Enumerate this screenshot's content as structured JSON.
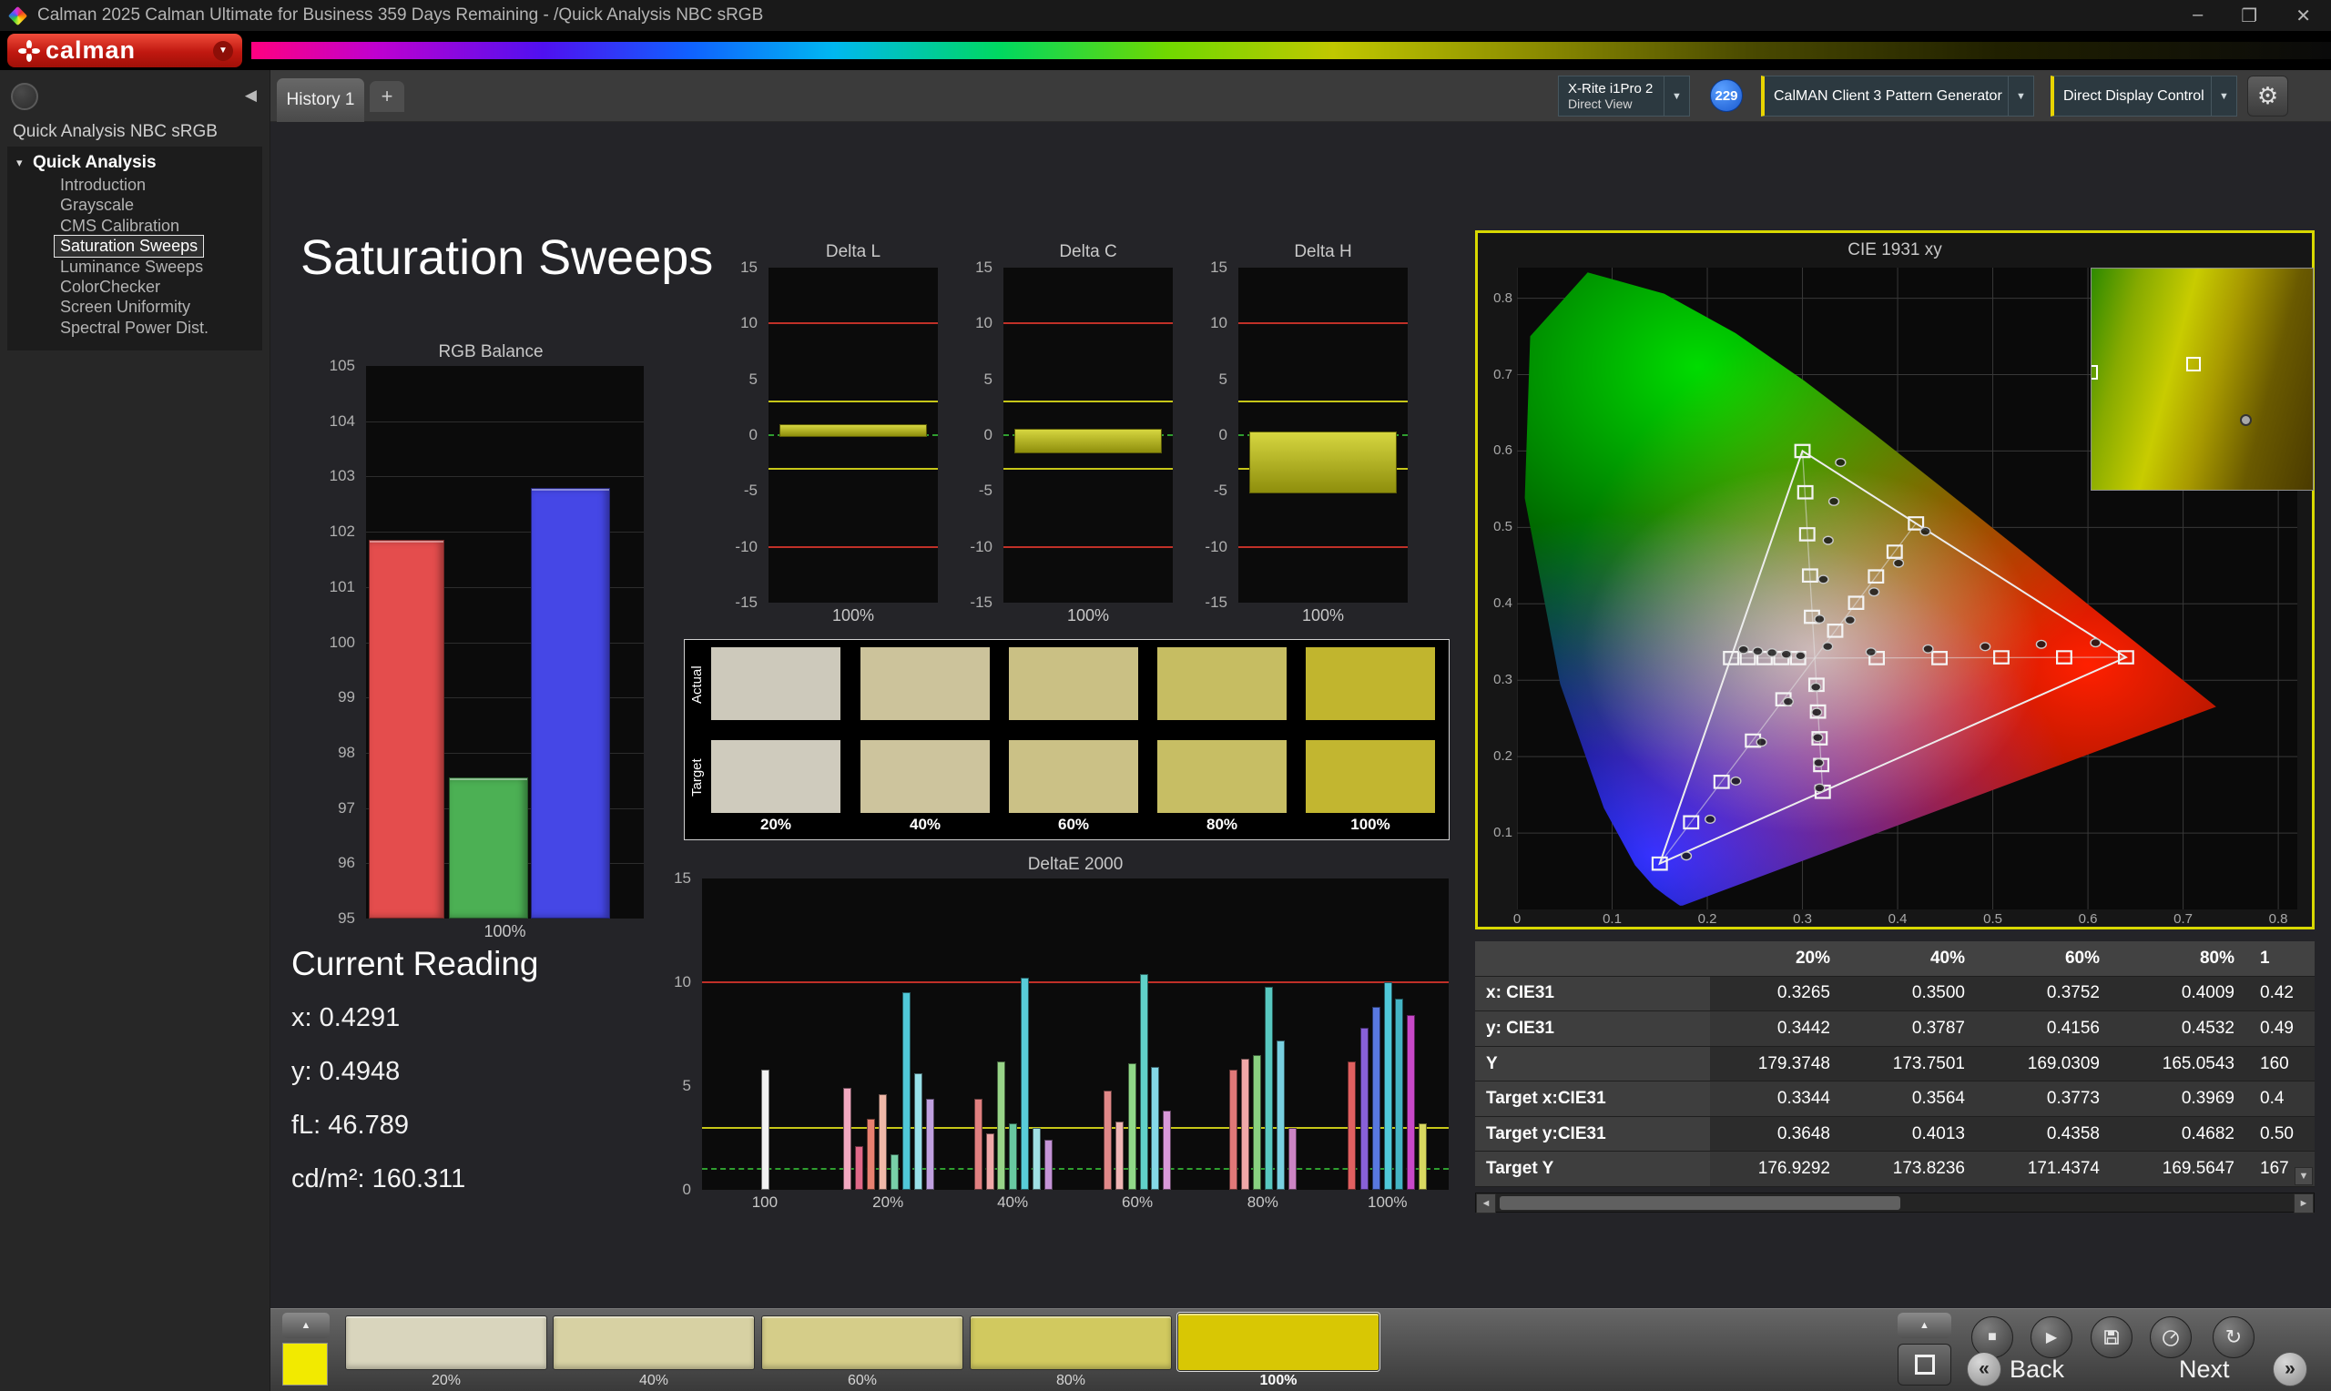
{
  "title_bar": {
    "title": "Calman 2025 Calman Ultimate for Business 359 Days Remaining  - /Quick Analysis NBC sRGB",
    "minimize": "–",
    "maximize": "❐",
    "close": "✕"
  },
  "brand": {
    "logo_text": "calman",
    "caret": "▼"
  },
  "tabs": {
    "history": "History 1",
    "add": "+"
  },
  "toolbar": {
    "meter_line1": "X-Rite i1Pro 2",
    "meter_line2": "Direct View",
    "meter_caret": "▼",
    "badge": "229",
    "pattern_generator": "CalMAN Client 3 Pattern Generator",
    "pattern_caret": "▼",
    "display_control": "Direct Display Control",
    "display_caret": "▼",
    "settings_icon": "⚙"
  },
  "sidebar": {
    "collapse_icon": "◀",
    "workflow_title": "Quick Analysis NBC sRGB",
    "root_label": "Quick Analysis",
    "items": [
      "Introduction",
      "Grayscale",
      "CMS Calibration",
      "Saturation Sweeps",
      "Luminance Sweeps",
      "ColorChecker",
      "Screen Uniformity",
      "Spectral Power Dist."
    ],
    "selected_index": 3
  },
  "page": {
    "title": "Saturation Sweeps"
  },
  "current_reading": {
    "heading": "Current Reading",
    "lines": [
      "x: 0.4291",
      "y: 0.4948",
      "fL: 46.789",
      "cd/m²: 160.311"
    ]
  },
  "swatch_grid": {
    "row_labels": [
      "Actual",
      "Target"
    ],
    "col_labels": [
      "20%",
      "40%",
      "60%",
      "80%",
      "100%"
    ],
    "actual_colors": [
      "#cdc9bb",
      "#ccc39b",
      "#cac084",
      "#c6bd62",
      "#c1b52e"
    ],
    "target_colors": [
      "#cfcbbd",
      "#cdc49d",
      "#cbc186",
      "#c7be64",
      "#c2b630"
    ]
  },
  "chart_data": [
    {
      "type": "bar",
      "title": "RGB Balance",
      "categories": [
        "Red",
        "Green",
        "Blue"
      ],
      "values": [
        101.85,
        97.55,
        102.8
      ],
      "colors": [
        "#e44d4d",
        "#4cb054",
        "#4547e6"
      ],
      "ylim": [
        95,
        105
      ],
      "yticks": [
        105,
        104,
        103,
        102,
        101,
        100,
        99,
        98,
        97,
        96,
        95
      ],
      "xlabel": "100%"
    },
    {
      "type": "bar",
      "title": "Delta L",
      "ylim": [
        -15,
        15
      ],
      "yticks": [
        15,
        10,
        5,
        0,
        -5,
        -10,
        -15
      ],
      "xlabel": "100%",
      "band_top": 1.0,
      "band_bottom": -0.2,
      "limits": {
        "red": [
          10,
          -10
        ],
        "yellow": [
          3,
          -3
        ],
        "green": [
          0
        ]
      }
    },
    {
      "type": "bar",
      "title": "Delta C",
      "ylim": [
        -15,
        15
      ],
      "yticks": [
        15,
        10,
        5,
        0,
        -5,
        -10,
        -15
      ],
      "xlabel": "100%",
      "band_top": 0.6,
      "band_bottom": -1.6,
      "limits": {
        "red": [
          10,
          -10
        ],
        "yellow": [
          3,
          -3
        ],
        "green": [
          0
        ]
      }
    },
    {
      "type": "bar",
      "title": "Delta H",
      "ylim": [
        -15,
        15
      ],
      "yticks": [
        15,
        10,
        5,
        0,
        -5,
        -10,
        -15
      ],
      "xlabel": "100%",
      "band_top": 0.3,
      "band_bottom": -5.2,
      "limits": {
        "red": [
          10,
          -10
        ],
        "yellow": [
          3,
          -3
        ],
        "green": [
          0
        ]
      }
    },
    {
      "type": "bar",
      "title": "DeltaE 2000",
      "ylim": [
        0,
        15
      ],
      "yticks": [
        15,
        10,
        5,
        0
      ],
      "limits": {
        "red": [
          10
        ],
        "yellow": [
          3
        ],
        "green": [
          1
        ]
      },
      "x_labels": [
        {
          "p": 0.084,
          "t": "100"
        },
        {
          "p": 0.249,
          "t": "20%"
        },
        {
          "p": 0.416,
          "t": "40%"
        },
        {
          "p": 0.583,
          "t": "60%"
        },
        {
          "p": 0.751,
          "t": "80%"
        },
        {
          "p": 0.918,
          "t": "100%"
        }
      ],
      "bars": [
        {
          "p": 0.084,
          "c": "#f2f2f2",
          "v": 5.8
        },
        {
          "p": 0.194,
          "c": "#f2a8c0",
          "v": 4.9
        },
        {
          "p": 0.21,
          "c": "#e06888",
          "v": 2.1
        },
        {
          "p": 0.226,
          "c": "#e88070",
          "v": 3.4
        },
        {
          "p": 0.242,
          "c": "#f0b8a8",
          "v": 4.6
        },
        {
          "p": 0.257,
          "c": "#78d0a8",
          "v": 1.7
        },
        {
          "p": 0.273,
          "c": "#50c8d8",
          "v": 9.5
        },
        {
          "p": 0.289,
          "c": "#98e0e8",
          "v": 5.6
        },
        {
          "p": 0.305,
          "c": "#c0a0e0",
          "v": 4.4
        },
        {
          "p": 0.369,
          "c": "#e08080",
          "v": 4.4
        },
        {
          "p": 0.385,
          "c": "#f0a8a8",
          "v": 2.7
        },
        {
          "p": 0.4,
          "c": "#98d488",
          "v": 6.2
        },
        {
          "p": 0.416,
          "c": "#68c8a0",
          "v": 3.2
        },
        {
          "p": 0.432,
          "c": "#58ccd8",
          "v": 10.2
        },
        {
          "p": 0.447,
          "c": "#a0e0e4",
          "v": 3.0
        },
        {
          "p": 0.463,
          "c": "#c493d6",
          "v": 2.4
        },
        {
          "p": 0.543,
          "c": "#e08888",
          "v": 4.8
        },
        {
          "p": 0.559,
          "c": "#f0b4b4",
          "v": 3.3
        },
        {
          "p": 0.575,
          "c": "#90d888",
          "v": 6.1
        },
        {
          "p": 0.591,
          "c": "#60d0c8",
          "v": 10.4
        },
        {
          "p": 0.606,
          "c": "#84d8e8",
          "v": 5.9
        },
        {
          "p": 0.622,
          "c": "#d898d8",
          "v": 3.8
        },
        {
          "p": 0.711,
          "c": "#e07878",
          "v": 5.8
        },
        {
          "p": 0.727,
          "c": "#f0a8a8",
          "v": 6.3
        },
        {
          "p": 0.743,
          "c": "#88d080",
          "v": 6.5
        },
        {
          "p": 0.759,
          "c": "#58c8c0",
          "v": 9.8
        },
        {
          "p": 0.774,
          "c": "#78d0e0",
          "v": 7.2
        },
        {
          "p": 0.79,
          "c": "#cc84c4",
          "v": 3.0
        },
        {
          "p": 0.87,
          "c": "#e06060",
          "v": 6.2
        },
        {
          "p": 0.886,
          "c": "#8860d8",
          "v": 7.8
        },
        {
          "p": 0.902,
          "c": "#5878e0",
          "v": 8.8
        },
        {
          "p": 0.918,
          "c": "#50c8d8",
          "v": 10.0
        },
        {
          "p": 0.933,
          "c": "#44b4c4",
          "v": 9.2
        },
        {
          "p": 0.949,
          "c": "#c848c8",
          "v": 8.4
        },
        {
          "p": 0.965,
          "c": "#d8d860",
          "v": 3.2
        }
      ]
    },
    {
      "type": "scatter",
      "title": "CIE 1931 xy",
      "xlim": [
        0,
        0.82
      ],
      "ylim": [
        0,
        0.84
      ],
      "x_ticks": [
        0,
        0.1,
        0.2,
        0.3,
        0.4,
        0.5,
        0.6,
        0.7,
        0.8
      ],
      "y_ticks": [
        0.1,
        0.2,
        0.3,
        0.4,
        0.5,
        0.6,
        0.7,
        0.8
      ],
      "white_point": [
        0.313,
        0.329
      ],
      "srgb_triangle": [
        [
          0.64,
          0.33
        ],
        [
          0.3,
          0.6
        ],
        [
          0.15,
          0.06
        ]
      ],
      "sweep_endpoints": [
        [
          0.64,
          0.33
        ],
        [
          0.3,
          0.6
        ],
        [
          0.15,
          0.06
        ],
        [
          0.4193,
          0.5053
        ],
        [
          0.225,
          0.329
        ],
        [
          0.3213,
          0.154
        ]
      ],
      "targets": [
        [
          0.378,
          0.329
        ],
        [
          0.444,
          0.329
        ],
        [
          0.509,
          0.33
        ],
        [
          0.575,
          0.33
        ],
        [
          0.64,
          0.33
        ],
        [
          0.31,
          0.383
        ],
        [
          0.308,
          0.437
        ],
        [
          0.305,
          0.491
        ],
        [
          0.303,
          0.546
        ],
        [
          0.3,
          0.6
        ],
        [
          0.28,
          0.275
        ],
        [
          0.248,
          0.221
        ],
        [
          0.215,
          0.167
        ],
        [
          0.183,
          0.114
        ],
        [
          0.15,
          0.06
        ],
        [
          0.3344,
          0.3648
        ],
        [
          0.3564,
          0.4013
        ],
        [
          0.3773,
          0.4358
        ],
        [
          0.3969,
          0.4682
        ],
        [
          0.4193,
          0.5053
        ],
        [
          0.2954,
          0.329
        ],
        [
          0.2778,
          0.329
        ],
        [
          0.2602,
          0.329
        ],
        [
          0.2426,
          0.329
        ],
        [
          0.225,
          0.329
        ],
        [
          0.3147,
          0.294
        ],
        [
          0.3163,
          0.259
        ],
        [
          0.318,
          0.224
        ],
        [
          0.3197,
          0.189
        ],
        [
          0.3213,
          0.154
        ]
      ],
      "measured": [
        [
          0.372,
          0.337
        ],
        [
          0.432,
          0.341
        ],
        [
          0.492,
          0.344
        ],
        [
          0.551,
          0.347
        ],
        [
          0.608,
          0.349
        ],
        [
          0.318,
          0.38
        ],
        [
          0.322,
          0.432
        ],
        [
          0.327,
          0.483
        ],
        [
          0.333,
          0.534
        ],
        [
          0.34,
          0.585
        ],
        [
          0.285,
          0.272
        ],
        [
          0.257,
          0.219
        ],
        [
          0.23,
          0.168
        ],
        [
          0.203,
          0.118
        ],
        [
          0.178,
          0.07
        ],
        [
          0.3265,
          0.3442
        ],
        [
          0.35,
          0.3787
        ],
        [
          0.3752,
          0.4156
        ],
        [
          0.4009,
          0.4532
        ],
        [
          0.4291,
          0.4948
        ],
        [
          0.298,
          0.332
        ],
        [
          0.283,
          0.334
        ],
        [
          0.268,
          0.336
        ],
        [
          0.253,
          0.338
        ],
        [
          0.238,
          0.34
        ],
        [
          0.314,
          0.291
        ],
        [
          0.315,
          0.258
        ],
        [
          0.316,
          0.225
        ],
        [
          0.317,
          0.192
        ],
        [
          0.318,
          0.159
        ]
      ]
    }
  ],
  "table": {
    "headers": [
      "",
      "20%",
      "40%",
      "60%",
      "80%",
      "1"
    ],
    "rows": [
      {
        "label": "x: CIE31",
        "values": [
          "0.3265",
          "0.3500",
          "0.3752",
          "0.4009",
          "0.42"
        ]
      },
      {
        "label": "y: CIE31",
        "values": [
          "0.3442",
          "0.3787",
          "0.4156",
          "0.4532",
          "0.49"
        ]
      },
      {
        "label": "Y",
        "values": [
          "179.3748",
          "173.7501",
          "169.0309",
          "165.0543",
          "160"
        ]
      },
      {
        "label": "Target x:CIE31",
        "values": [
          "0.3344",
          "0.3564",
          "0.3773",
          "0.3969",
          "0.4"
        ]
      },
      {
        "label": "Target y:CIE31",
        "values": [
          "0.3648",
          "0.4013",
          "0.4358",
          "0.4682",
          "0.50"
        ]
      },
      {
        "label": "Target Y",
        "values": [
          "176.9292",
          "173.8236",
          "171.4374",
          "169.5647",
          "167"
        ]
      }
    ]
  },
  "bottom_bar": {
    "selected_swatch_color": "#f2ea00",
    "swatches": [
      {
        "label": "20%",
        "color": "#d9d5bd"
      },
      {
        "label": "40%",
        "color": "#d7d1a3"
      },
      {
        "label": "60%",
        "color": "#d5cd89"
      },
      {
        "label": "80%",
        "color": "#d1c95f"
      },
      {
        "label": "100%",
        "color": "#d8c704",
        "selected": true
      }
    ],
    "back_label": "Back",
    "next_label": "Next"
  }
}
